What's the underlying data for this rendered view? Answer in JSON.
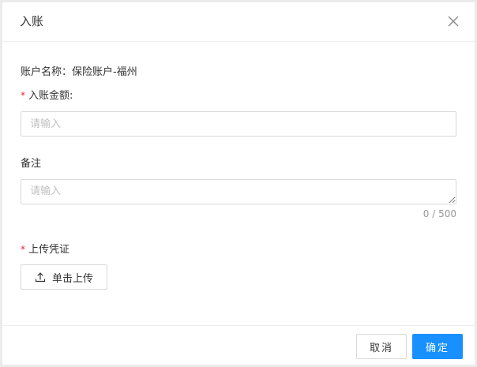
{
  "dialog": {
    "title": "入账",
    "close_icon": "close-icon"
  },
  "form": {
    "account_label": "账户名称：",
    "account_value": "保险账户-福州",
    "amount": {
      "label": "入账金额:",
      "required": true,
      "placeholder": "请输入",
      "value": ""
    },
    "remark": {
      "label": "备注",
      "placeholder": "请输入",
      "value": "",
      "counter": "0 / 500"
    },
    "voucher": {
      "label": "上传凭证",
      "required": true,
      "upload_label": "单击上传",
      "upload_icon": "upload-icon"
    },
    "required_mark": "*"
  },
  "footer": {
    "cancel_label": "取消",
    "ok_label": "确定"
  },
  "colors": {
    "primary": "#1890ff",
    "required": "#f5222d",
    "border": "#d9d9d9",
    "placeholder": "#bfbfbf"
  }
}
